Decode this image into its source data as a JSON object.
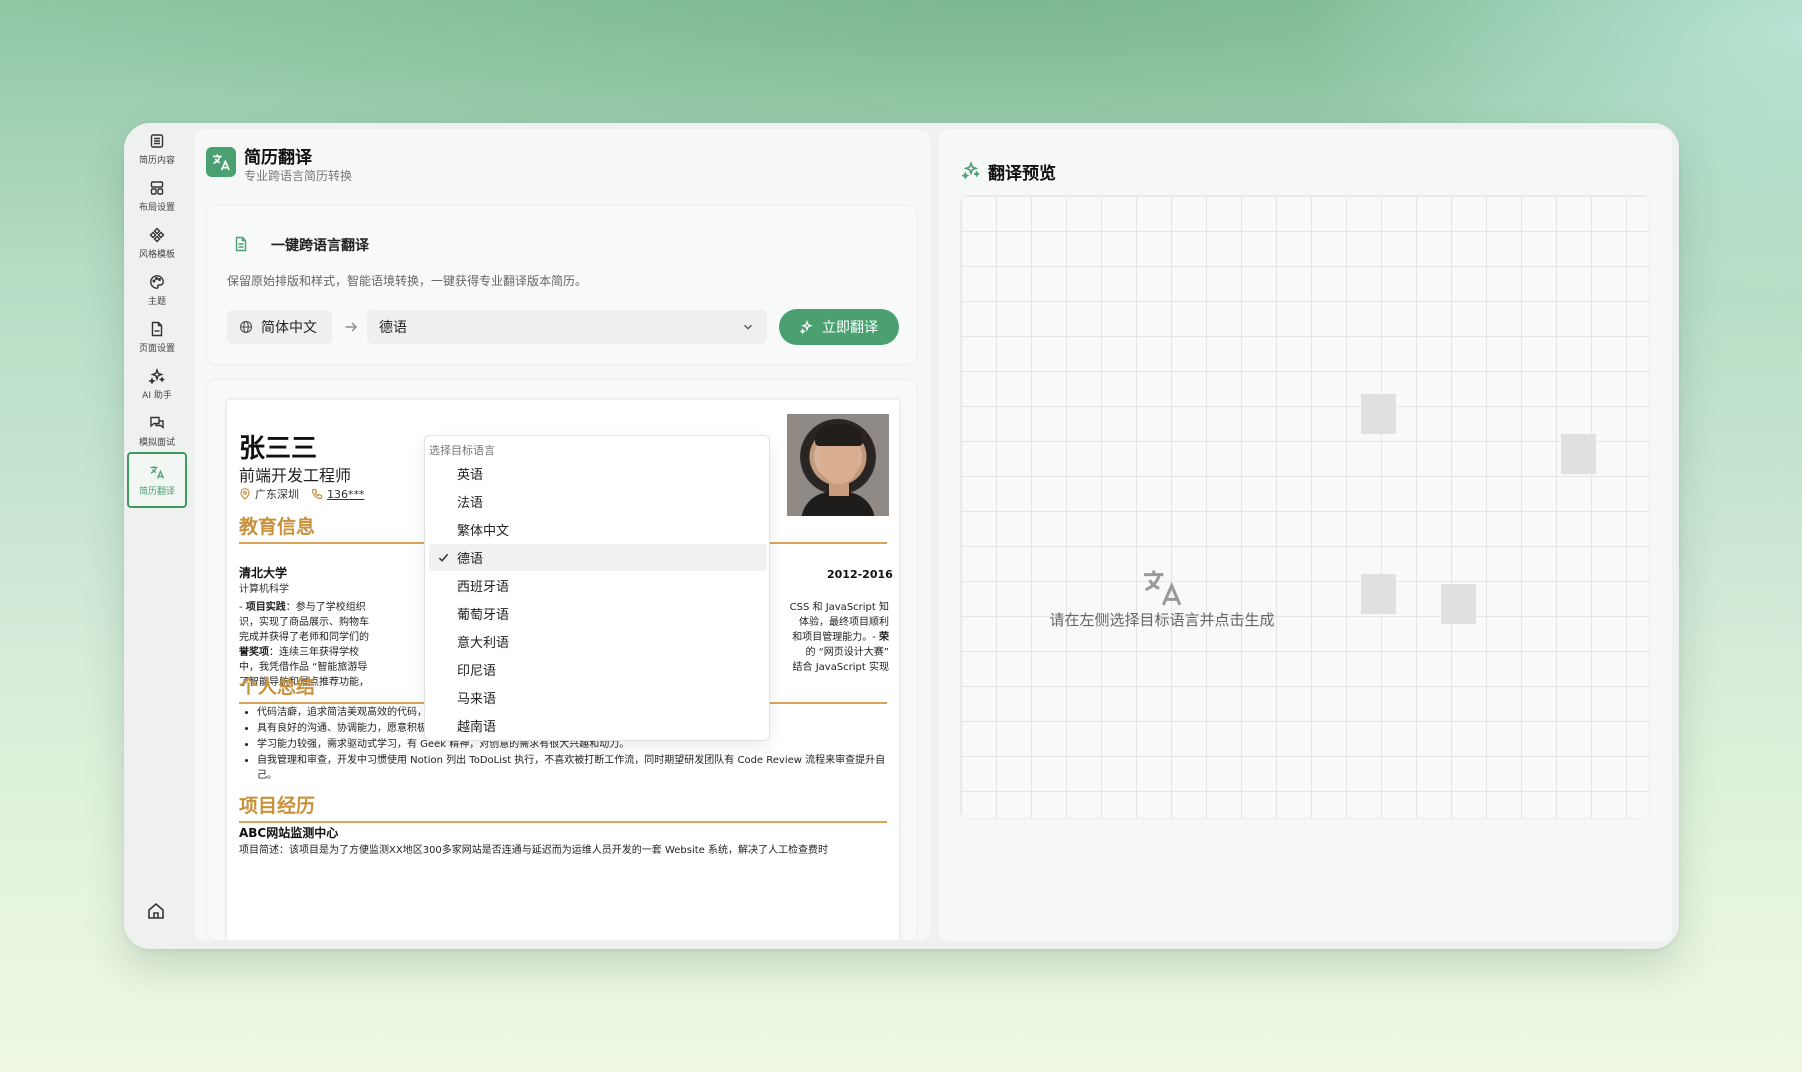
{
  "sidebar": {
    "items": [
      {
        "label": "简历内容",
        "icon": "list-icon"
      },
      {
        "label": "布局设置",
        "icon": "layout-icon"
      },
      {
        "label": "风格模板",
        "icon": "template-icon"
      },
      {
        "label": "主题",
        "icon": "palette-icon"
      },
      {
        "label": "页面设置",
        "icon": "file-icon"
      },
      {
        "label": "AI 助手",
        "icon": "sparkles-icon"
      },
      {
        "label": "模拟面试",
        "icon": "chat-icon"
      },
      {
        "label": "简历翻译",
        "icon": "translate-icon",
        "active": true
      }
    ],
    "home_icon": "home-icon"
  },
  "header": {
    "title": "简历翻译",
    "subtitle": "专业跨语言简历转换"
  },
  "translate_card": {
    "title": "一键跨语言翻译",
    "description": "保留原始排版和样式，智能语境转换，一键获得专业翻译版本简历。",
    "source_language": "简体中文",
    "target_language": "德语",
    "button_label": "立即翻译"
  },
  "dropdown": {
    "heading": "选择目标语言",
    "options": [
      "英语",
      "法语",
      "繁体中文",
      "德语",
      "西班牙语",
      "葡萄牙语",
      "意大利语",
      "印尼语",
      "马来语",
      "越南语"
    ],
    "selected": "德语"
  },
  "resume": {
    "name": "张三三",
    "job": "前端开发工程师",
    "location": "广东深圳",
    "phone": "136***",
    "sections": {
      "education": "教育信息",
      "summary": "个人总结",
      "projects": "项目经历"
    },
    "school": "清北大学",
    "major": "计算机科学",
    "years": "2012-2016",
    "edu_text": {
      "l1a": "- ",
      "l1b": "项目实践",
      "l1c": "：参与了学校组织",
      "l1d": "CSS 和 JavaScript 知",
      "l2a": "识，实现了商品展示、购物车",
      "l2b": "体验，最终项目顺利",
      "l3a": "完成并获得了老师和同学们的",
      "l3b": "和项目管理能力。- ",
      "l3c": "荣",
      "l4a": "誉奖项",
      "l4b": "：连续三年获得学校",
      "l4c": "的 “网页设计大赛”",
      "l5a": "中，我凭借作品 “智能旅游导",
      "l5b": "结合 JavaScript 实现",
      "l6": "了智能导航和景点推荐功能，"
    },
    "summary_items": [
      "代码洁癖，追求简洁美观高效的代码，期望研发团队有明确的编码规范以及模块化、工程化的开发思想并遵循。",
      "具有良好的沟通、协调能力，愿意积极参与产品讨论，但期望团队有高效的沟通方式以便快速开发。",
      "学习能力较强，需求驱动式学习，有 Geek 精神，对创意的需求有很大兴趣和动力。",
      "自我管理和审查，开发中习惯使用 Notion 列出 ToDoList 执行，不喜欢被打断工作流，同时期望研发团队有 Code Review 流程来审查提升自己。"
    ],
    "project_name": "ABC网站监测中心",
    "project_desc": "项目简述：该项目是为了方便监测XX地区300多家网站是否连通与延迟而为运维人员开发的一套 Website 系统，解决了人工检查费时"
  },
  "preview": {
    "title": "翻译预览",
    "empty_text": "请在左侧选择目标语言并点击生成"
  },
  "colors": {
    "accent": "#4aa070",
    "resume_accent": "#c8913a"
  }
}
